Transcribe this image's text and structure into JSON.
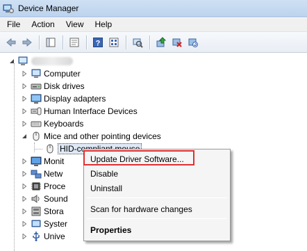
{
  "window": {
    "title": "Device Manager"
  },
  "menu": [
    "File",
    "Action",
    "View",
    "Help"
  ],
  "toolbar": {
    "buttons": [
      "back-arrow-icon",
      "forward-arrow-icon",
      "console-tree-icon",
      "properties-icon",
      "help-icon",
      "device-view-icon",
      "update-driver-icon",
      "uninstall-icon",
      "scan-hardware-icon"
    ]
  },
  "tree": {
    "items": [
      {
        "label": "Computer",
        "icon": "computer-icon"
      },
      {
        "label": "Disk drives",
        "icon": "disk-drive-icon"
      },
      {
        "label": "Display adapters",
        "icon": "display-adapter-icon"
      },
      {
        "label": "Human Interface Devices",
        "icon": "hid-icon"
      },
      {
        "label": "Keyboards",
        "icon": "keyboard-icon"
      },
      {
        "label": "Mice and other pointing devices",
        "icon": "mouse-icon"
      },
      {
        "label": "HID-compliant mouse",
        "icon": "mouse-icon"
      },
      {
        "label": "Monit",
        "icon": "monitor-icon"
      },
      {
        "label": "Netw",
        "icon": "network-icon"
      },
      {
        "label": "Proce",
        "icon": "processor-icon"
      },
      {
        "label": "Sound",
        "icon": "sound-icon"
      },
      {
        "label": "Stora",
        "icon": "storage-icon"
      },
      {
        "label": "Syster",
        "icon": "system-icon"
      },
      {
        "label": "Unive",
        "icon": "usb-icon"
      }
    ]
  },
  "context_menu": {
    "items": [
      "Update Driver Software...",
      "Disable",
      "Uninstall",
      "Scan for hardware changes",
      "Properties"
    ]
  },
  "colors": {
    "highlight_border": "#e03030",
    "title_bar": "#c6daf1"
  }
}
